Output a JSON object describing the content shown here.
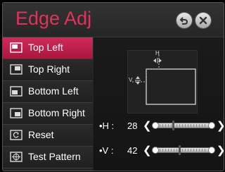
{
  "header": {
    "title": "Edge Adj",
    "back_icon": "back-arrow-icon",
    "close_icon": "close-icon"
  },
  "menu": {
    "items": [
      {
        "label": "Top Left",
        "icon": "top-left-icon",
        "selected": true
      },
      {
        "label": "Top Right",
        "icon": "top-right-icon",
        "selected": false
      },
      {
        "label": "Bottom Left",
        "icon": "bottom-left-icon",
        "selected": false
      },
      {
        "label": "Bottom Right",
        "icon": "bottom-right-icon",
        "selected": false
      },
      {
        "label": "Reset",
        "icon": "reset-icon",
        "selected": false
      },
      {
        "label": "Test Pattern",
        "icon": "test-pattern-icon",
        "selected": false
      }
    ]
  },
  "diagram": {
    "h_label": "H",
    "v_label": "V"
  },
  "sliders": {
    "h": {
      "label": "•H :",
      "value": "28",
      "level": 0.28
    },
    "v": {
      "label": "•V :",
      "value": "42",
      "level": 0.42
    }
  },
  "colors": {
    "accent": "#e0325a",
    "selected_bg": "#c0224d"
  }
}
